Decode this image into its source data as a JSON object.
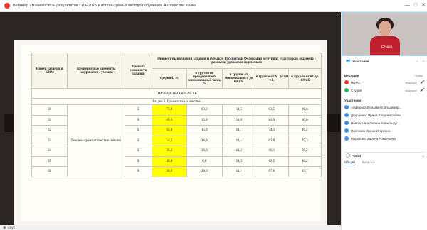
{
  "window": {
    "title": "Вебинар «Взаимосвязь результатов ГИА-2025 и используемых методов обучения. Английский язык»",
    "controls": [
      "—",
      "□",
      "✕"
    ]
  },
  "slide": {
    "headers": {
      "task_number": "Номер задания в КИМ",
      "elements": "Проверяемые элементы содержания / умения",
      "level": "Уровень сложности задания",
      "percent_group": "Процент выполнения задания в субъекте Российской Федерации в группах участников экзамена с разными уровнями подготовки",
      "average": "средний, %",
      "group_fail": "в группе не преодолевших минимальный балл, %",
      "group_min60": "в группе от минимального до 60 т.б.",
      "group_61_80": "в группе от 61 до 80 т.б.",
      "group_81_100": "в группе от 81 до 100 т.б."
    },
    "section_title": "ПИСЬМЕННАЯ ЧАСТЬ",
    "subsection_title": "Раздел 3. Грамматика и лексика",
    "merged_element": "Лексико-грамматические навыки",
    "rows": [
      {
        "num": "30",
        "level": "Б",
        "avg": "73,0",
        "fail": "63,2",
        "min60": "64,5",
        "g6180": "83,5",
        "g81100": "96,6"
      },
      {
        "num": "31",
        "level": "Б",
        "avg": "69,9",
        "fail": "15,8",
        "min60": "56,8",
        "g6180": "83,9",
        "g81100": "96,6"
      },
      {
        "num": "32",
        "level": "Б",
        "avg": "63,6",
        "fail": "15,8",
        "min60": "44,1",
        "g6180": "74,1",
        "g81100": "86,2"
      },
      {
        "num": "33",
        "level": "Б",
        "avg": "54,5",
        "fail": "36,8",
        "min60": "44,1",
        "g6180": "62,9",
        "g81100": "79,3"
      },
      {
        "num": "34",
        "level": "Б",
        "avg": "56,5",
        "fail": "36,8",
        "min60": "43,2",
        "g6180": "66,1",
        "g81100": "86,2"
      },
      {
        "num": "35",
        "level": "Б",
        "avg": "49,0",
        "fail": "0,0",
        "min60": "34,5",
        "g6180": "62,5",
        "g81100": "86,2"
      },
      {
        "num": "36",
        "level": "Б",
        "avg": "56,5",
        "fail": "26,3",
        "min60": "44,1",
        "g6180": "67,0",
        "g81100": "89,7"
      }
    ]
  },
  "bottombar": {
    "label": "слух"
  },
  "sidebar": {
    "video_badge": "Студия",
    "participants_title": "Участники",
    "participants_count": "10",
    "presenters_title": "Ведущие",
    "presenters_right": "Права",
    "presenters": [
      {
        "name": "НИРО",
        "role": "ведущий"
      },
      {
        "name": "Студия",
        "role": "ведущий"
      }
    ],
    "participants_title2": "Участники",
    "participants": [
      "Алферова Елизавета Владимир...",
      "Дидоренко Ирина Владимировна",
      "Новоротина Галина Александр...",
      "Полякова Ирина Игоревна",
      "Морозова Марина Романовна"
    ],
    "chat_title": "Чаты",
    "tabs": [
      "Общий",
      "Вопросы"
    ]
  }
}
